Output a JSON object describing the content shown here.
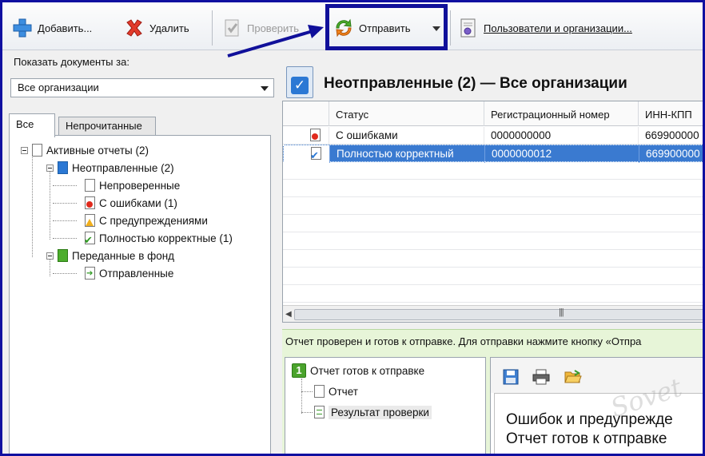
{
  "toolbar": {
    "add_label": "Добавить...",
    "delete_label": "Удалить",
    "check_label": "Проверить",
    "send_label": "Отправить",
    "users_label": "Пользователи и организации..."
  },
  "filter": {
    "show_label": "Показать документы за:",
    "org_value": "Все организации"
  },
  "tabs": {
    "all": "Все",
    "unread": "Непрочитанные"
  },
  "tree": {
    "active": "Активные отчеты (2)",
    "unsent": "Неотправленные (2)",
    "unchecked": "Непроверенные",
    "errors": "С ошибками (1)",
    "warnings": "С предупреждениями",
    "correct": "Полностью корректные (1)",
    "fund": "Переданные в фонд",
    "sent": "Отправленные"
  },
  "header": {
    "title": "Неотправленные (2)  — Все организации"
  },
  "grid": {
    "columns": [
      "Статус",
      "Регистрационный номер",
      "ИНН-КПП"
    ],
    "rows": [
      {
        "status": "С ошибками",
        "reg": "0000000000",
        "inn": "669900000"
      },
      {
        "status": "Полностью корректный",
        "reg": "0000000012",
        "inn": "669900000"
      }
    ]
  },
  "info": {
    "text": "Отчет проверен и готов к отправке. Для отправки нажмите кнопку «Отпра"
  },
  "subtree": {
    "step_num": "1",
    "ready": "Отчет готов к отправке",
    "report": "Отчет",
    "result": "Результат проверки"
  },
  "preview": {
    "line1": "Ошибок и предупрежде",
    "line2": "Отчет готов к отправке"
  },
  "watermark": {
    "text": "Sovet"
  },
  "colors": {
    "accent": "#1010a0",
    "selection": "#3a7ad0",
    "info_bg": "#e7f5d8"
  }
}
